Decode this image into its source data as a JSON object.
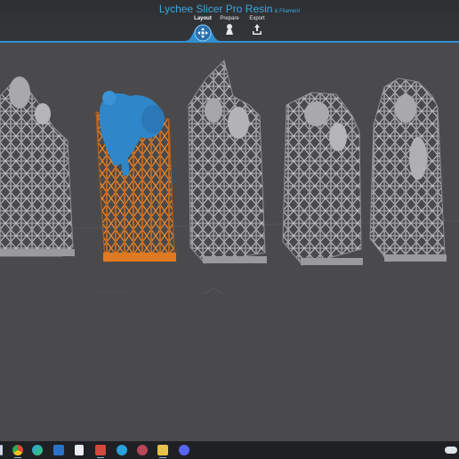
{
  "app": {
    "title": "Lychee Slicer Pro Resin",
    "subtitle": "& Filament",
    "accent_color": "#38a8e0"
  },
  "tabs": [
    {
      "label": "Layout",
      "icon": "move-arrows-icon",
      "active": true
    },
    {
      "label": "Prepare",
      "icon": "supports-icon",
      "active": false
    },
    {
      "label": "Export",
      "icon": "export-tray-icon",
      "active": false
    }
  ],
  "viewport": {
    "background": "#4a4a4c",
    "model_color": "#a9a9ab",
    "selected_support_color": "#e07a22",
    "selected_model_color": "#2f86c8"
  },
  "taskbar": {
    "icons": [
      "windows-icon",
      "chrome-icon",
      "edge-icon",
      "mail-icon",
      "file-icon",
      "app-red-icon",
      "telegram-icon",
      "lychee-icon",
      "folder-icon",
      "discord-icon",
      "cloud-tray-icon"
    ]
  }
}
